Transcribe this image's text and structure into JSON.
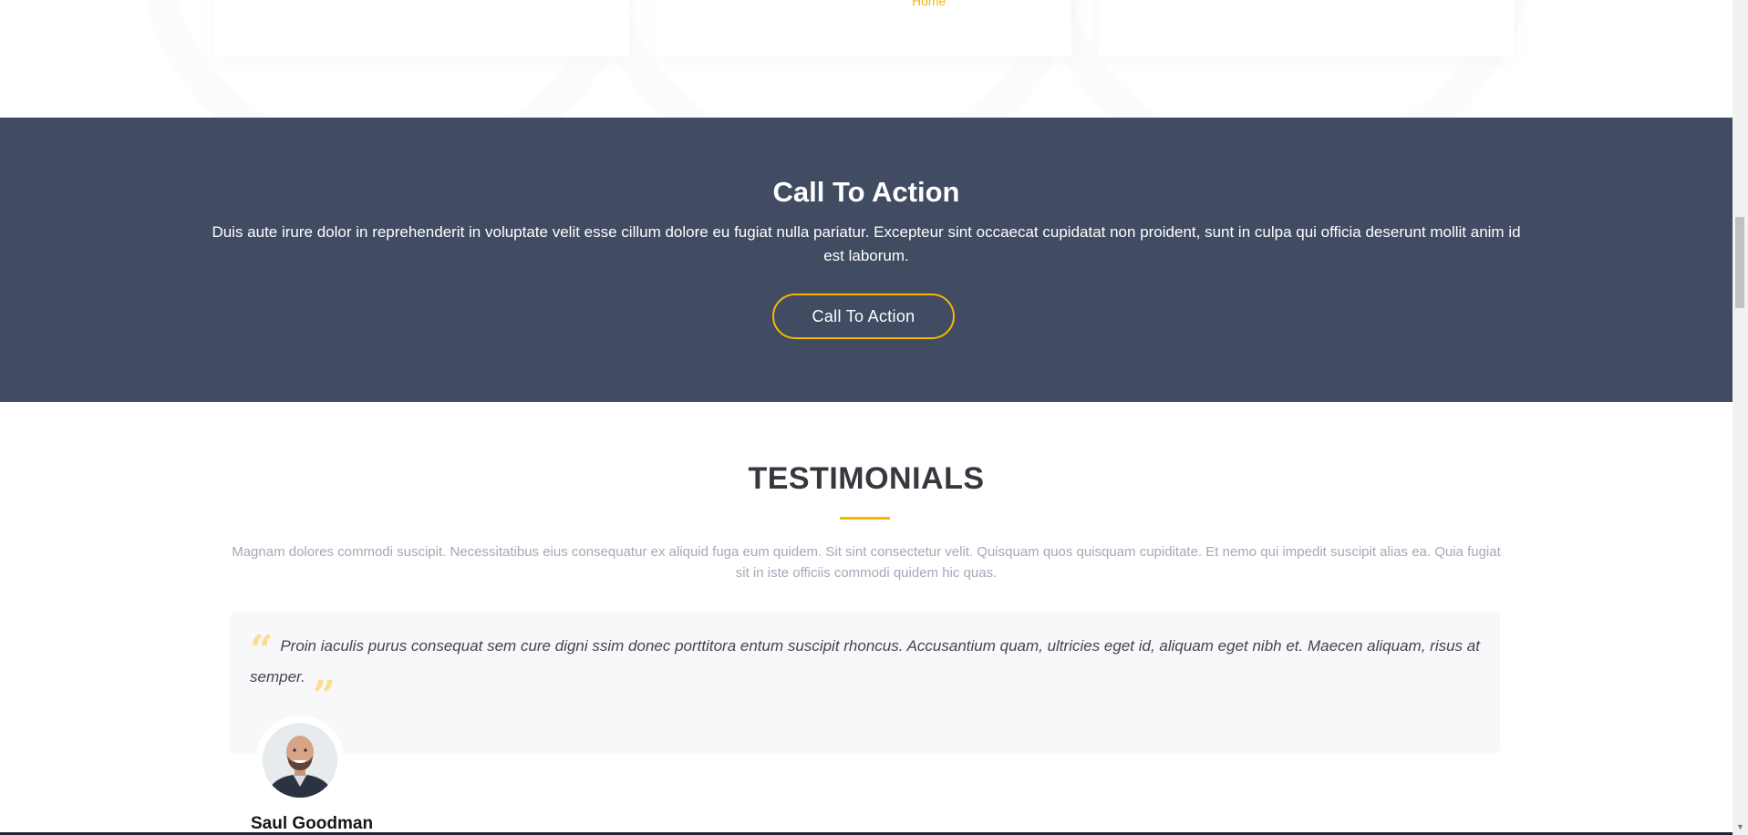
{
  "top": {
    "link_label": "Home"
  },
  "cta": {
    "title": "Call To Action",
    "text": "Duis aute irure dolor in reprehenderit in voluptate velit esse cillum dolore eu fugiat nulla pariatur. Excepteur sint occaecat cupidatat non proident, sunt in culpa qui officia deserunt mollit anim id est laborum.",
    "button_label": "Call To Action"
  },
  "testimonials": {
    "title": "TESTIMONIALS",
    "intro": "Magnam dolores commodi suscipit. Necessitatibus eius consequatur ex aliquid fuga eum quidem. Sit sint consectetur velit. Quisquam quos quisquam cupiditate. Et nemo qui impedit suscipit alias ea. Quia fugiat sit in iste officiis commodi quidem hic quas.",
    "items": [
      {
        "quote": "Proin iaculis purus consequat sem cure digni ssim donec porttitora entum suscipit rhoncus. Accusantium quam, ultricies eget id, aliquam eget nibh et. Maecen aliquam, risus at semper.",
        "author": "Saul Goodman"
      }
    ]
  },
  "colors": {
    "accent": "#f5b800",
    "cta_background": "#414b62",
    "heading": "#37373f",
    "muted_text": "#a4a9b9",
    "quote_box": "#f8f8fa"
  },
  "icons": {
    "quote_open": "quote-left-icon",
    "quote_close": "quote-right-icon",
    "scroll_down": "arrow-down-icon"
  }
}
